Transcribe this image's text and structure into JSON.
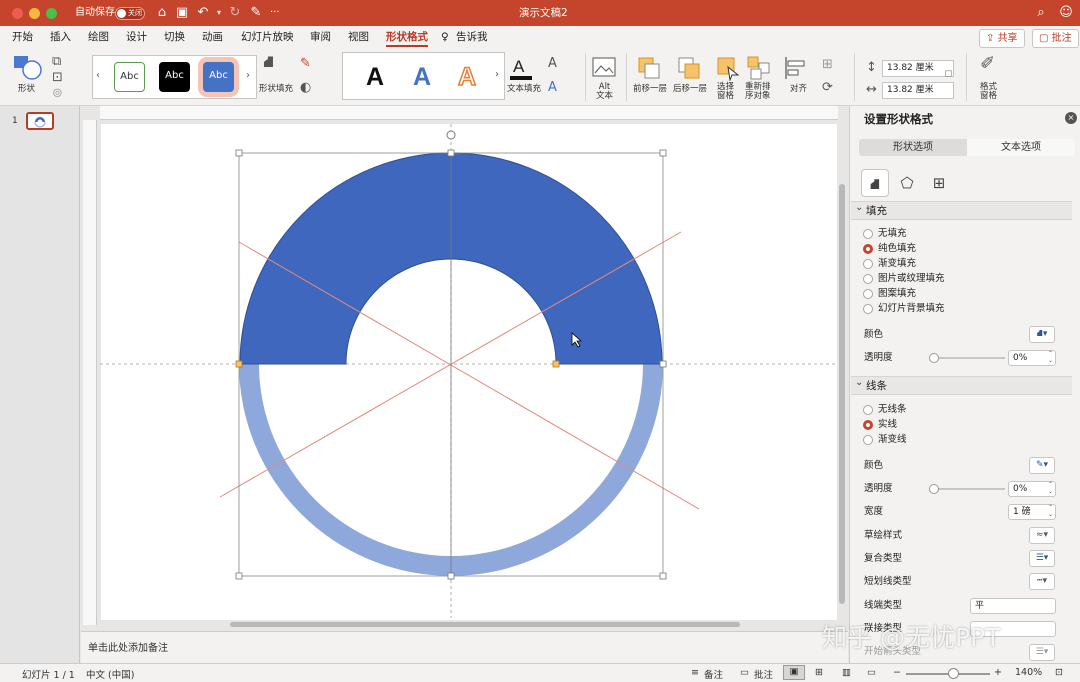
{
  "titlebar": {
    "autosave_label": "自动保存",
    "autosave_state": "关闭",
    "doc_title": "演示文稿2",
    "more": "···"
  },
  "tabs": [
    "开始",
    "插入",
    "绘图",
    "设计",
    "切换",
    "动画",
    "幻灯片放映",
    "审阅",
    "视图",
    "形状格式",
    "告诉我"
  ],
  "active_tab": "形状格式",
  "share_label": "共享",
  "comments_label": "批注",
  "ribbon": {
    "shape_label": "形状",
    "style_samples": [
      "Abc",
      "Abc",
      "Abc"
    ],
    "shape_fill_label": "形状填充",
    "wordart_letters": [
      "A",
      "A",
      "A"
    ],
    "text_fill_label": "文本填充",
    "alt_text_label": "Alt\n文本",
    "bring_forward_label": "前移一层",
    "send_backward_label": "后移一层",
    "selection_pane_label": "选择\n窗格",
    "reorder_label": "重新排\n序对象",
    "align_label": "对齐",
    "height_value": "13.82 厘米",
    "width_value": "13.82 厘米",
    "format_pane_label": "格式\n窗格"
  },
  "slides": {
    "thumb_number": "1"
  },
  "notes_placeholder": "单击此处添加备注",
  "format_pane": {
    "title": "设置形状格式",
    "tabs": [
      "形状选项",
      "文本选项"
    ],
    "fill_section": "填充",
    "fill_options": [
      "无填充",
      "纯色填充",
      "渐变填充",
      "图片或纹理填充",
      "图案填充",
      "幻灯片背景填充"
    ],
    "fill_selected": 1,
    "color_label": "颜色",
    "transparency_label": "透明度",
    "fill_transparency": "0%",
    "line_section": "线条",
    "line_options": [
      "无线条",
      "实线",
      "渐变线"
    ],
    "line_selected": 1,
    "line_color_label": "颜色",
    "line_transparency_label": "透明度",
    "line_transparency": "0%",
    "width_label": "宽度",
    "width_value": "1 磅",
    "sketch_label": "草绘样式",
    "compound_label": "复合类型",
    "dash_label": "短划线类型",
    "cap_label": "线端类型",
    "cap_value": "平",
    "join_label": "联接类型",
    "begin_arrow_label": "开始箭头类型"
  },
  "status": {
    "slide_counter": "幻灯片 1 / 1",
    "language": "中文 (中国)",
    "notes_label": "备注",
    "comments_label": "批注",
    "zoom": "140%"
  },
  "watermark": "知乎 @无忧PPT",
  "colors": {
    "brand": "#c4452b",
    "shape_fill": "#3f67bd",
    "ring_fill": "#8ea8db",
    "guide_line": "#e08a7e"
  }
}
